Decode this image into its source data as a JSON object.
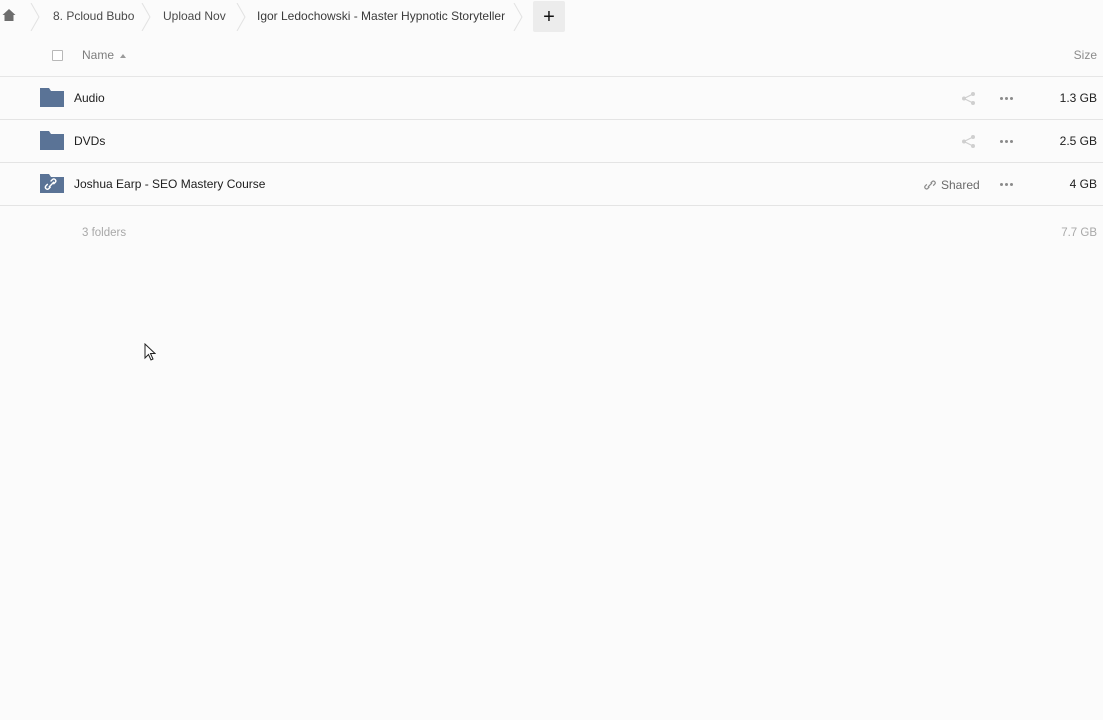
{
  "breadcrumb": {
    "home_icon": "home-icon",
    "items": [
      {
        "label": "8. Pcloud Bubo"
      },
      {
        "label": "Upload Nov"
      },
      {
        "label": "Igor Ledochowski - Master Hypnotic Storyteller"
      }
    ],
    "add_label": "+"
  },
  "header": {
    "name_label": "Name",
    "size_label": "Size",
    "sort_icon": "sort-ascending-icon"
  },
  "rows": [
    {
      "name": "Audio",
      "size": "1.3 GB",
      "icon": "folder-icon",
      "shared": false,
      "shared_label": ""
    },
    {
      "name": "DVDs",
      "size": "2.5 GB",
      "icon": "folder-icon",
      "shared": false,
      "shared_label": ""
    },
    {
      "name": "Joshua Earp - SEO Mastery Course",
      "size": "4 GB",
      "icon": "shared-folder-icon",
      "shared": true,
      "shared_label": "Shared"
    }
  ],
  "summary": {
    "count": "3 folders",
    "total": "7.7 GB"
  },
  "colors": {
    "folder": "#5a7396",
    "add_button_bg": "#ececec",
    "divider": "#e4e4e4"
  }
}
